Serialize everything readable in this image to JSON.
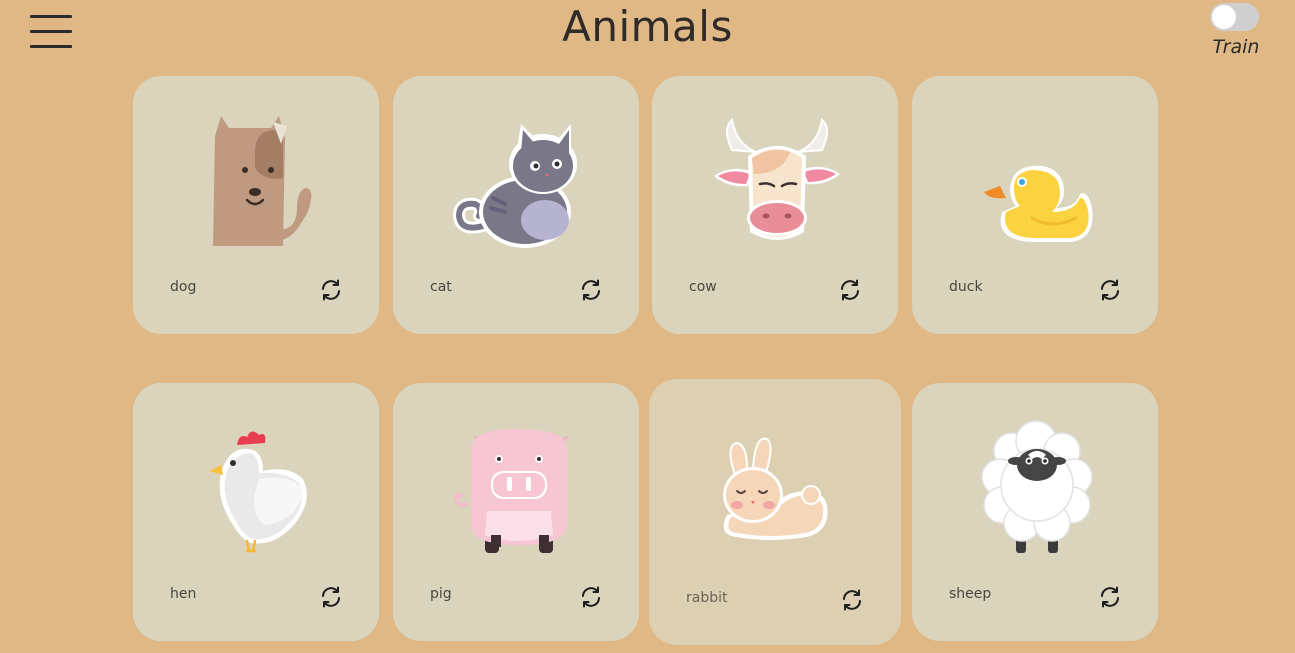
{
  "header": {
    "title": "Animals",
    "menu_icon": "hamburger-menu-icon"
  },
  "train_toggle": {
    "label": "Train",
    "on": false
  },
  "cards": [
    {
      "name": "dog",
      "icon": "dog-icon",
      "action_icon": "refresh-icon"
    },
    {
      "name": "cat",
      "icon": "cat-icon",
      "action_icon": "refresh-icon"
    },
    {
      "name": "cow",
      "icon": "cow-icon",
      "action_icon": "refresh-icon"
    },
    {
      "name": "duck",
      "icon": "duck-icon",
      "action_icon": "refresh-icon"
    },
    {
      "name": "hen",
      "icon": "hen-icon",
      "action_icon": "refresh-icon"
    },
    {
      "name": "pig",
      "icon": "pig-icon",
      "action_icon": "refresh-icon"
    },
    {
      "name": "rabbit",
      "icon": "rabbit-icon",
      "action_icon": "refresh-icon"
    },
    {
      "name": "sheep",
      "icon": "sheep-icon",
      "action_icon": "refresh-icon"
    }
  ],
  "colors": {
    "background": "#e0b886",
    "card": "#dad4bc",
    "card_hover": "#dccfb2",
    "text": "#2e2b28"
  }
}
